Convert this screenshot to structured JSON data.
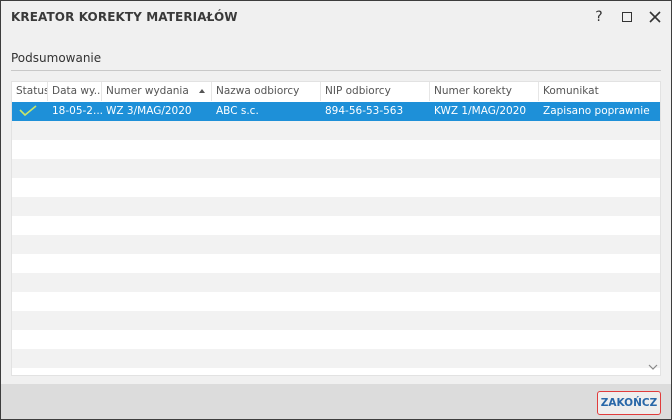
{
  "window": {
    "title": "KREATOR KOREKTY MATERIAŁÓW",
    "help_label": "?"
  },
  "section": {
    "label": "Podsumowanie"
  },
  "grid": {
    "columns": [
      "Status",
      "Data wy...",
      "Numer wydania",
      "Nazwa odbiorcy",
      "NIP odbiorcy",
      "Numer korekty",
      "Komunikat"
    ],
    "sorted_column": "Numer wydania",
    "rows": [
      {
        "status_icon": "check-icon",
        "data": "18-05-2...",
        "numer_wydania": "WZ 3/MAG/2020",
        "nazwa_odbiorcy": "ABC s.c.",
        "nip": "894-56-53-563",
        "numer_korekty": "KWZ 1/MAG/2020",
        "komunikat": "Zapisano poprawnie"
      }
    ]
  },
  "footer": {
    "finish_label": "ZAKOŃCZ"
  },
  "colors": {
    "selection": "#1e90d8",
    "accent_border": "#e03c3c",
    "button_text": "#2867a8"
  }
}
